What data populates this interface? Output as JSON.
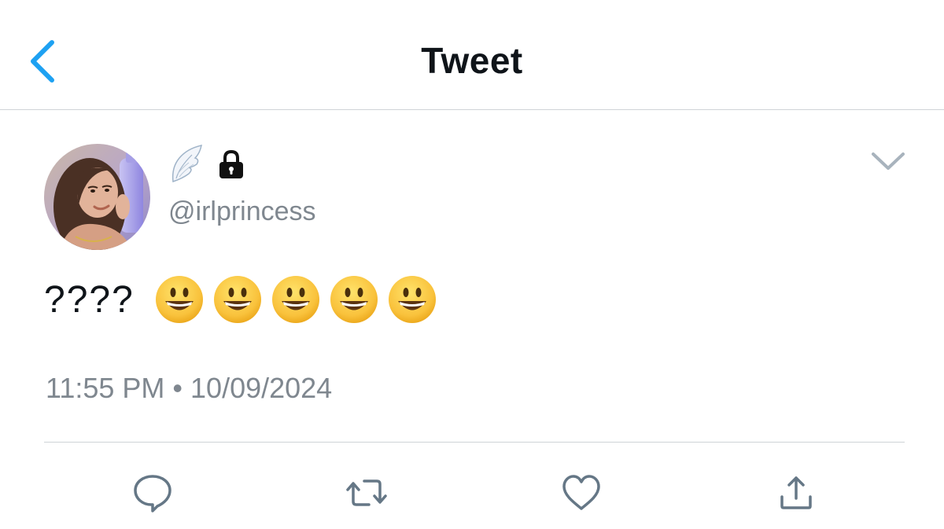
{
  "nav": {
    "title": "Tweet",
    "back_icon": "chevron-left-icon",
    "accent_color": "#1da1f2"
  },
  "tweet": {
    "author": {
      "display_name_icons": [
        "angel-wing-emoji-icon",
        "lock-icon"
      ],
      "handle": "@irlprincess",
      "avatar": "profile-photo"
    },
    "text_prefix": "????",
    "emojis": [
      "grinning-face-icon",
      "grinning-face-icon",
      "grinning-face-icon",
      "grinning-face-icon",
      "grinning-face-icon"
    ],
    "timestamp": "11:55 PM • 10/09/2024",
    "menu_icon": "chevron-down-icon"
  },
  "actions": [
    {
      "name": "reply",
      "icon": "reply-icon"
    },
    {
      "name": "retweet",
      "icon": "retweet-icon"
    },
    {
      "name": "like",
      "icon": "heart-icon"
    },
    {
      "name": "share",
      "icon": "share-icon"
    }
  ],
  "colors": {
    "secondary_text": "#7f878f",
    "action_icon": "#657786",
    "divider": "#cfd3d7"
  }
}
